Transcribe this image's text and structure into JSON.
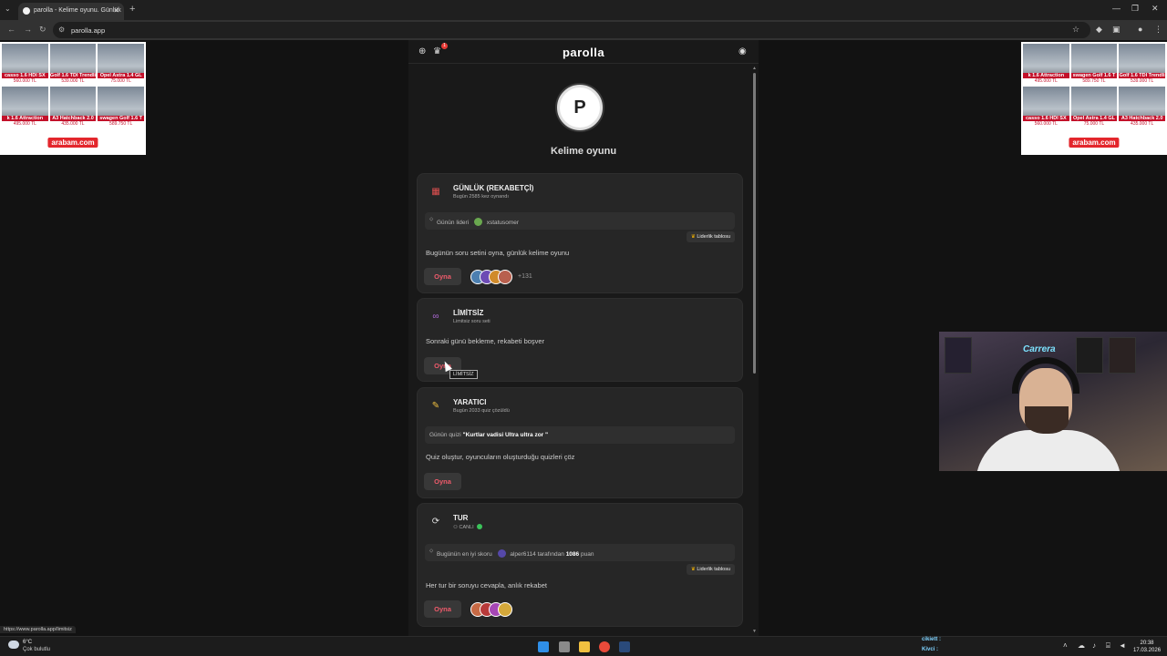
{
  "browser": {
    "tab_title": "parolla - Kelime oyunu. Günlük",
    "url": "parolla.app",
    "status_url": "https://www.parolla.app/limitsiz"
  },
  "ads": {
    "left": {
      "cells": [
        {
          "title": "casso 1.6 HDI SX",
          "price": "560.000 TL"
        },
        {
          "title": "Golf 1.6 TDI Trendli",
          "price": "539.000 TL"
        },
        {
          "title": "Opel Astra 1.4 GL",
          "price": "75.000 TL"
        },
        {
          "title": "k 1.6 Attraction",
          "price": "495.000 TL"
        },
        {
          "title": "A3 Hatchback 2.0",
          "price": "435.000 TL"
        },
        {
          "title": "swagen Golf 1.6 T",
          "price": "589.750 TL"
        }
      ],
      "logo": "arabam.com"
    },
    "right": {
      "cells": [
        {
          "title": "k 1.6 Attraction",
          "price": "495.000 TL"
        },
        {
          "title": "swagen Golf 1.6 T",
          "price": "589.750 TL"
        },
        {
          "title": "Golf 1.6 TDI Trendli",
          "price": "539.000 TL"
        },
        {
          "title": "casso 1.6 HDI SX",
          "price": "560.000 TL"
        },
        {
          "title": "Opel Astra 1.4 GL",
          "price": "75.000 TL"
        },
        {
          "title": "A3 Hatchback 2.0",
          "price": "435.000 TL"
        }
      ],
      "logo": "arabam.com"
    }
  },
  "app": {
    "brand": "parolla",
    "notification_count": "1",
    "logo_letter": "P",
    "subtitle": "Kelime oyunu",
    "accent_color": "#ef5b6b",
    "cards": {
      "daily": {
        "icon": "calendar-icon",
        "title": "GÜNLÜK (REKABETÇİ)",
        "sub": "Bugün 2585 kez oynandı",
        "leader_label": "Günün lideri",
        "leader_name": "xstatusomer",
        "leaderboard": "Liderlik tablosu",
        "desc": "Bugünün soru setini oyna, günlük kelime oyunu",
        "play": "Oyna",
        "more_players": "+131"
      },
      "unlimited": {
        "icon": "infinity-icon",
        "title": "LİMİTSİZ",
        "sub": "Limitsiz soru seti",
        "desc": "Sonraki günü bekleme, rekabeti boşver",
        "play": "Oyna",
        "tooltip": "LİMİTSİZ"
      },
      "creative": {
        "icon": "pencil-icon",
        "title": "YARATICI",
        "sub": "Bugün 2033 quiz çözüldü",
        "quiz_label": "Günün quizi",
        "quiz_name": "\"Kurtlar vadisi Ultra ultra zor \"",
        "desc": "Quiz oluştur, oyuncuların oluşturduğu quizleri çöz",
        "play": "Oyna"
      },
      "tour": {
        "icon": "refresh-icon",
        "title": "TUR",
        "sub": "CANLI",
        "best_label": "Bugünün en iyi skoru",
        "best_user": "alper6114",
        "best_by": "tarafından",
        "best_score": "1086",
        "best_unit": "puan",
        "leaderboard": "Liderlik tablosu",
        "desc": "Her tur bir soruyu cevapla, anlık rekabet",
        "play": "Oyna"
      }
    }
  },
  "stream": {
    "chat": [
      {
        "user": "cikiett :",
        "msg": ""
      },
      {
        "user": "Kivci :",
        "msg": ""
      }
    ],
    "neon_sign": "Carrera"
  },
  "taskbar": {
    "temp": "6°C",
    "weather": "Çok bulutlu",
    "time": "20:38",
    "date": "17.03.2026"
  }
}
